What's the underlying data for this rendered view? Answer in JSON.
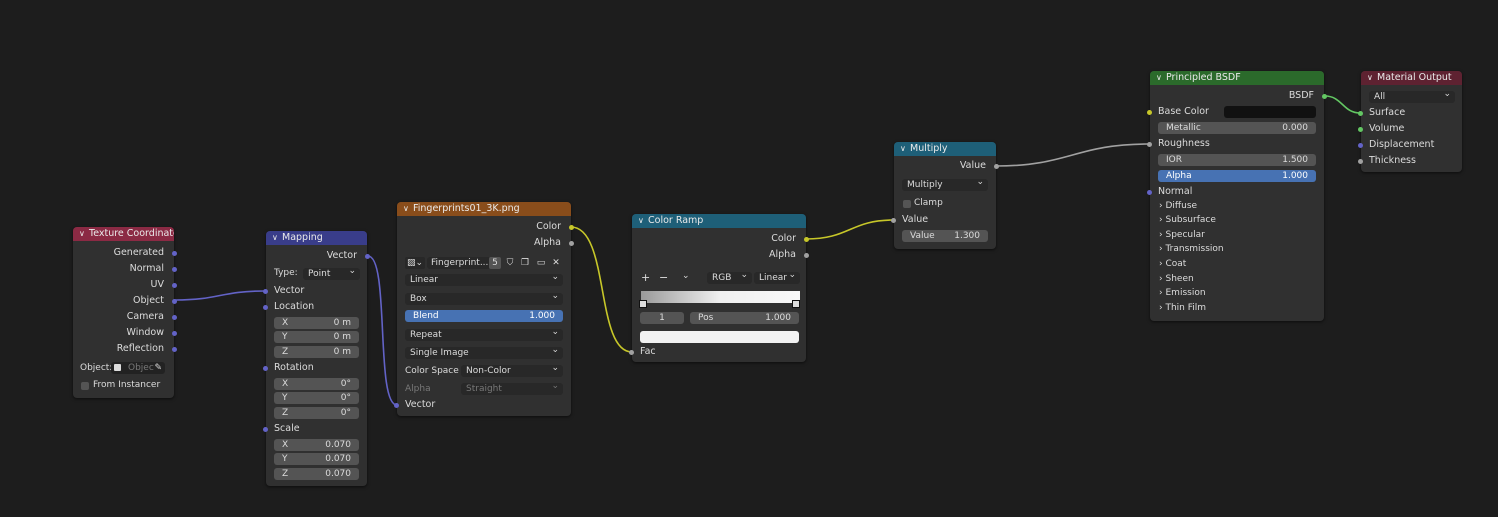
{
  "colors": {
    "texcoord_header": "#8b2a44",
    "mapping_header": "#393d8a",
    "image_header": "#894d1b",
    "colorramp_header": "#1e5f78",
    "multiply_header": "#1e5f78",
    "bsdf_header": "#2b6a2b",
    "output_header": "#5e2231",
    "wire_vector": "#6363c7",
    "wire_color": "#c7c729",
    "wire_value": "#a1a1a1",
    "wire_shader": "#63c763"
  },
  "texture_coordinate": {
    "title": "Texture Coordinate",
    "outputs": [
      "Generated",
      "Normal",
      "UV",
      "Object",
      "Camera",
      "Window",
      "Reflection"
    ],
    "object_label": "Object:",
    "object_placeholder": "Objec",
    "from_instancer": "From Instancer"
  },
  "mapping": {
    "title": "Mapping",
    "output": "Vector",
    "type_label": "Type:",
    "type_value": "Point",
    "vector_in": "Vector",
    "location_label": "Location",
    "location": [
      {
        "axis": "X",
        "value": "0 m"
      },
      {
        "axis": "Y",
        "value": "0 m"
      },
      {
        "axis": "Z",
        "value": "0 m"
      }
    ],
    "rotation_label": "Rotation",
    "rotation": [
      {
        "axis": "X",
        "value": "0°"
      },
      {
        "axis": "Y",
        "value": "0°"
      },
      {
        "axis": "Z",
        "value": "0°"
      }
    ],
    "scale_label": "Scale",
    "scale": [
      {
        "axis": "X",
        "value": "0.070"
      },
      {
        "axis": "Y",
        "value": "0.070"
      },
      {
        "axis": "Z",
        "value": "0.070"
      }
    ]
  },
  "image_texture": {
    "title": "Fingerprints01_3K.png",
    "out_color": "Color",
    "out_alpha": "Alpha",
    "image_name": "Fingerprint...",
    "users": "5",
    "interpolation": "Linear",
    "projection": "Box",
    "blend_label": "Blend",
    "blend_value": "1.000",
    "extension": "Repeat",
    "source": "Single Image",
    "color_space_label": "Color Space",
    "color_space": "Non-Color",
    "alpha_label": "Alpha",
    "alpha_mode": "Straight",
    "vector_in": "Vector"
  },
  "color_ramp": {
    "title": "Color Ramp",
    "out_color": "Color",
    "out_alpha": "Alpha",
    "add": "+",
    "remove": "−",
    "menu": "⌄",
    "color_mode": "RGB",
    "interpolation": "Linear",
    "stop_index": "1",
    "pos_label": "Pos",
    "pos_value": "1.000",
    "fac_in": "Fac"
  },
  "multiply": {
    "title": "Multiply",
    "out_value": "Value",
    "operation": "Multiply",
    "clamp": "Clamp",
    "value_in": "Value",
    "value_label": "Value",
    "value": "1.300"
  },
  "principled": {
    "title": "Principled BSDF",
    "out": "BSDF",
    "base_color": "Base Color",
    "metallic_label": "Metallic",
    "metallic": "0.000",
    "roughness": "Roughness",
    "ior_label": "IOR",
    "ior": "1.500",
    "alpha_label": "Alpha",
    "alpha": "1.000",
    "normal": "Normal",
    "panels": [
      "Diffuse",
      "Subsurface",
      "Specular",
      "Transmission",
      "Coat",
      "Sheen",
      "Emission",
      "Thin Film"
    ]
  },
  "material_output": {
    "title": "Material Output",
    "target": "All",
    "inputs": [
      "Surface",
      "Volume",
      "Displacement",
      "Thickness"
    ]
  }
}
